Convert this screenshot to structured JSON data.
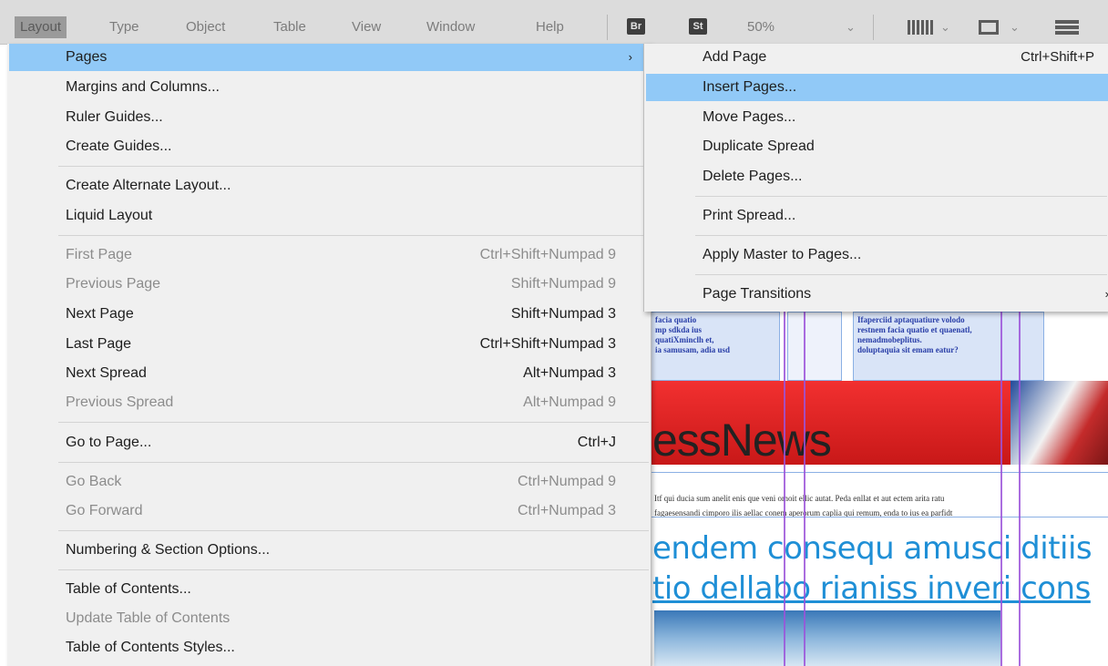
{
  "menubar": {
    "items": [
      {
        "label": "Layout"
      },
      {
        "label": "Type"
      },
      {
        "label": "Object"
      },
      {
        "label": "Table"
      },
      {
        "label": "View"
      },
      {
        "label": "Window"
      },
      {
        "label": "Help"
      }
    ],
    "badge_br": "Br",
    "badge_st": "St",
    "zoom": "50%",
    "chevron": "⌄"
  },
  "layout_menu": {
    "items": [
      {
        "label": "Pages",
        "shortcut": "",
        "arrow": "›"
      },
      {
        "label": "Margins and Columns...",
        "shortcut": ""
      },
      {
        "label": "Ruler Guides...",
        "shortcut": ""
      },
      {
        "label": "Create Guides...",
        "shortcut": ""
      },
      {
        "label": "Create Alternate Layout...",
        "shortcut": ""
      },
      {
        "label": "Liquid Layout",
        "shortcut": ""
      },
      {
        "label": "First Page",
        "shortcut": "Ctrl+Shift+Numpad 9"
      },
      {
        "label": "Previous Page",
        "shortcut": "Shift+Numpad 9"
      },
      {
        "label": "Next Page",
        "shortcut": "Shift+Numpad 3"
      },
      {
        "label": "Last Page",
        "shortcut": "Ctrl+Shift+Numpad 3"
      },
      {
        "label": "Next Spread",
        "shortcut": "Alt+Numpad 3"
      },
      {
        "label": "Previous Spread",
        "shortcut": "Alt+Numpad 9"
      },
      {
        "label": "Go to Page...",
        "shortcut": "Ctrl+J"
      },
      {
        "label": "Go Back",
        "shortcut": "Ctrl+Numpad 9"
      },
      {
        "label": "Go Forward",
        "shortcut": "Ctrl+Numpad 3"
      },
      {
        "label": "Numbering & Section Options...",
        "shortcut": ""
      },
      {
        "label": "Table of Contents...",
        "shortcut": ""
      },
      {
        "label": "Update Table of Contents",
        "shortcut": ""
      },
      {
        "label": "Table of Contents Styles...",
        "shortcut": ""
      }
    ]
  },
  "pages_submenu": {
    "items": [
      {
        "label": "Add Page",
        "shortcut": "Ctrl+Shift+P"
      },
      {
        "label": "Insert Pages...",
        "shortcut": ""
      },
      {
        "label": "Move Pages...",
        "shortcut": ""
      },
      {
        "label": "Duplicate Spread",
        "shortcut": ""
      },
      {
        "label": "Delete Pages...",
        "shortcut": ""
      },
      {
        "label": "Print Spread...",
        "shortcut": ""
      },
      {
        "label": "Apply Master to Pages...",
        "shortcut": ""
      },
      {
        "label": "Page Transitions",
        "shortcut": "",
        "arrow": "›"
      }
    ]
  },
  "document": {
    "box1_lines": [
      "facia quatio",
      "mp sdkda ius",
      "quatiXminclh et,",
      "ia samusam, adia usd"
    ],
    "box2_lines": [
      "Ifaperciid aptaquatiure volodo",
      "restnem facia quatio et quaenatl,",
      "nemadmobeplitus.",
      "doluptaquia sit emam eatur?"
    ],
    "masthead": "essNews",
    "small_line_1": "Itf qui ducia sum anelit enis que veni omoit ellic autat. Peda enllat et aut ectem arita ratu",
    "small_line_2": "fagaesensandi cimporo ilis aellac conem aperorum caplia qui remum, enda to ius ea parfidt",
    "headline_1": "endem consequ amusci ditiis",
    "headline_2": "tio dellabo rianiss inveri cons"
  },
  "colors": {
    "highlight": "#91c9f7",
    "menu_bg": "#f0f0f0",
    "guide": "#9b53d9",
    "headline": "#1f8fd6",
    "masthead_bar": "#e02020"
  }
}
